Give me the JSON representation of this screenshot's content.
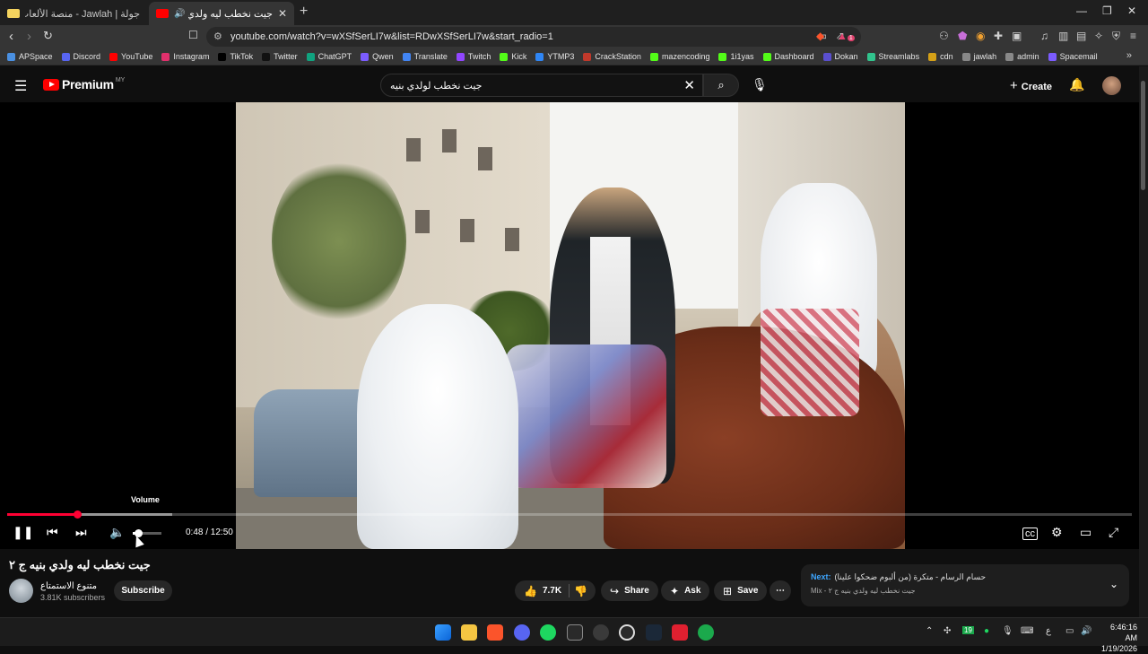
{
  "browser": {
    "tabs": [
      {
        "title": "جولة | Jawlah - منصة الألعاب التفاعلية",
        "active": false
      },
      {
        "title": "جيت نخطب ليه ولدي بنيه ج ٢ -",
        "active": true
      }
    ],
    "url": "youtube.com/watch?v=wXSfSerLI7w&list=RDwXSfSerLI7w&start_radio=1",
    "bookmarks": [
      "APSpace",
      "Discord",
      "YouTube",
      "Instagram",
      "TikTok",
      "Twitter",
      "ChatGPT",
      "Qwen",
      "Translate",
      "Twitch",
      "Kick",
      "YTMP3",
      "CrackStation",
      "mazencoding",
      "1i1yas",
      "Dashboard",
      "Dokan",
      "Streamlabs",
      "cdn",
      "jawlah",
      "admin",
      "Spacemail"
    ],
    "extension_badge": "1"
  },
  "youtube": {
    "logo_text": "Premium",
    "region": "MY",
    "search_query": "جيت نخطب لولدي بنيه",
    "create_label": "Create"
  },
  "player": {
    "tooltip": "Volume",
    "time_display": "0:48 / 12:50",
    "progress_fraction": 0.062,
    "volume_fraction": 0.18
  },
  "video": {
    "title": "جيت نخطب ليه ولدي بنيه ج ٢",
    "channel": "متنوع الاستمتاع",
    "subscribers": "3.81K subscribers",
    "subscribe_label": "Subscribe",
    "likes": "7.7K",
    "share_label": "Share",
    "ask_label": "Ask",
    "save_label": "Save"
  },
  "next": {
    "label": "Next:",
    "title": "حسام الرسام - متكرة (من ألبوم ضحكوا علينا)",
    "mix": "Mix - جيت نخطب ليه ولدي بنيه ج ٢"
  },
  "taskbar": {
    "time": "6:46:16 AM",
    "date": "1/19/2026",
    "tray_badge": "19",
    "lang": "ع"
  }
}
